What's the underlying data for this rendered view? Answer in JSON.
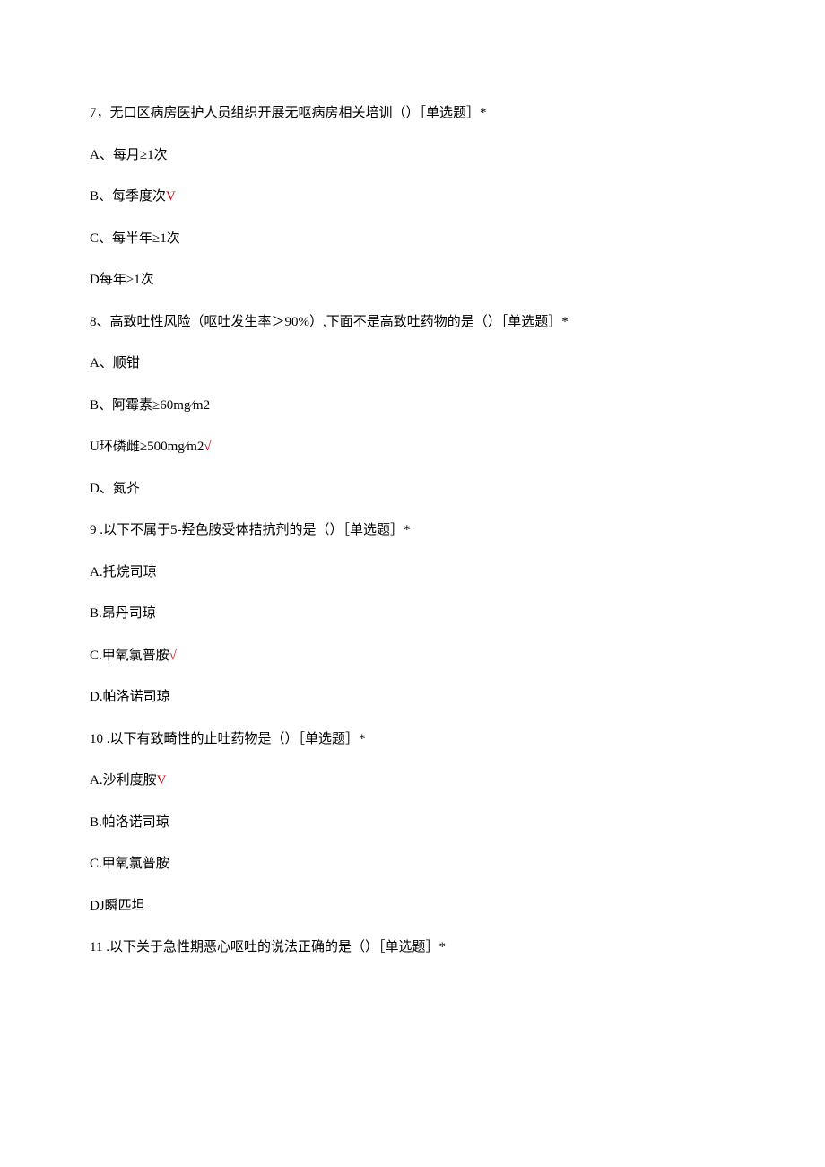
{
  "questions": [
    {
      "stem": "7，无口区病房医护人员组织开展无呕病房相关培训（）［单选题］*",
      "options": [
        {
          "text": "A、每月≥1次",
          "correct": false
        },
        {
          "text": "B、每季度次",
          "correct": true,
          "checkMark": "V"
        },
        {
          "text": "C、每半年≥1次",
          "correct": false
        },
        {
          "text": "D每年≥1次",
          "correct": false
        }
      ]
    },
    {
      "stem": "8、高致吐性风险（呕吐发生率＞90%）,下面不是高致吐药物的是（）［单选题］*",
      "options": [
        {
          "text": "A、顺钳",
          "correct": false
        },
        {
          "text": "B、阿霉素≥60mg⁄m2",
          "correct": false
        },
        {
          "text": "U环磷雌≥500mg⁄m2",
          "correct": true,
          "checkMark": "√"
        },
        {
          "text": "D、氮芥",
          "correct": false
        }
      ]
    },
    {
      "stem": "9  .以下不属于5-羟色胺受体拮抗剂的是（）［单选题］*",
      "options": [
        {
          "text": "A.托烷司琼",
          "correct": false
        },
        {
          "text": "B.昂丹司琼",
          "correct": false
        },
        {
          "text": "C.甲氧氯普胺",
          "correct": true,
          "checkMark": "√"
        },
        {
          "text": "D.帕洛诺司琼",
          "correct": false
        }
      ]
    },
    {
      "stem": "10  .以下有致畸性的止吐药物是（）［单选题］*",
      "options": [
        {
          "text": "A.沙利度胺",
          "correct": true,
          "checkMark": "V"
        },
        {
          "text": "B.帕洛诺司琼",
          "correct": false
        },
        {
          "text": "C.甲氧氯普胺",
          "correct": false
        },
        {
          "text": "DJ瞬匹坦",
          "correct": false
        }
      ]
    },
    {
      "stem": "11  .以下关于急性期恶心呕吐的说法正确的是（）［单选题］*",
      "options": []
    }
  ]
}
